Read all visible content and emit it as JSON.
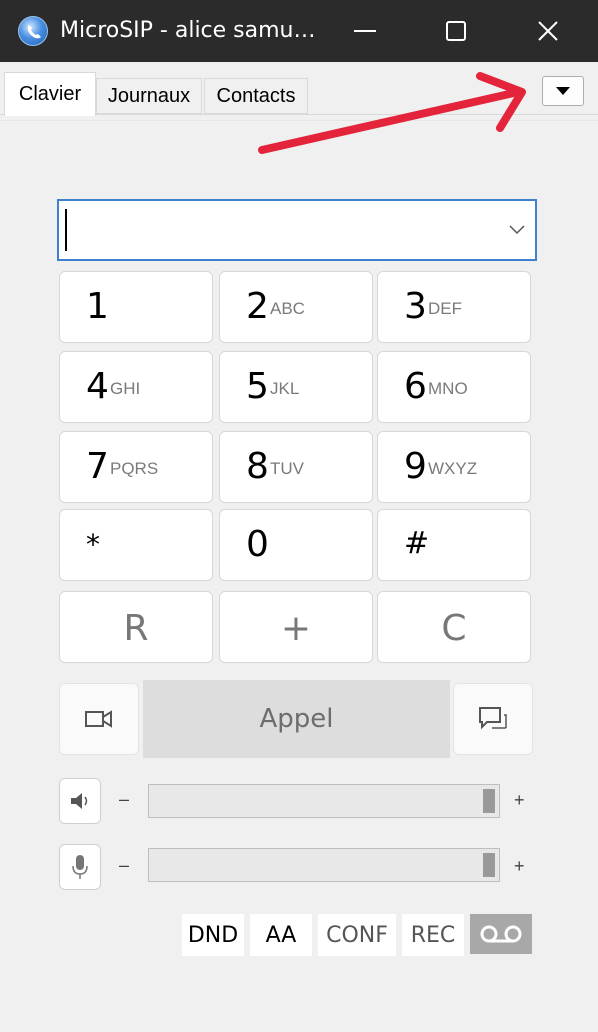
{
  "window": {
    "title": "MicroSIP - alice samu…",
    "icon": "microsip-logo-icon",
    "controls": [
      "minimize-icon",
      "maximize-icon",
      "close-icon"
    ]
  },
  "tabs": [
    {
      "label": "Clavier",
      "active": true
    },
    {
      "label": "Journaux",
      "active": false
    },
    {
      "label": "Contacts",
      "active": false
    }
  ],
  "menu_button": {
    "icon": "caret-down-icon"
  },
  "number_input": {
    "value": "",
    "icon": "chevron-down-icon"
  },
  "keypad": [
    {
      "digit": "1",
      "letters": ""
    },
    {
      "digit": "2",
      "letters": "ABC"
    },
    {
      "digit": "3",
      "letters": "DEF"
    },
    {
      "digit": "4",
      "letters": "GHI"
    },
    {
      "digit": "5",
      "letters": "JKL"
    },
    {
      "digit": "6",
      "letters": "MNO"
    },
    {
      "digit": "7",
      "letters": "PQRS"
    },
    {
      "digit": "8",
      "letters": "TUV"
    },
    {
      "digit": "9",
      "letters": "WXYZ"
    },
    {
      "digit": "*",
      "letters": ""
    },
    {
      "digit": "0",
      "letters": ""
    },
    {
      "digit": "#",
      "letters": ""
    }
  ],
  "function_keys": [
    "R",
    "+",
    "C"
  ],
  "call_row": {
    "video_icon": "video-camera-icon",
    "call_label": "Appel",
    "message_icon": "chat-bubble-icon"
  },
  "speaker": {
    "icon": "speaker-icon",
    "minus": "–",
    "plus": "+",
    "level": 1.0
  },
  "microphone": {
    "icon": "microphone-icon",
    "minus": "–",
    "plus": "+",
    "level": 1.0
  },
  "toggles": [
    "DND",
    "AA",
    "CONF",
    "REC"
  ],
  "voicemail": {
    "icon": "voicemail-icon"
  },
  "colors": {
    "annotation_arrow": "#e3243b",
    "input_focus": "#3f7fd0",
    "title_bar": "#2b2b2b"
  }
}
